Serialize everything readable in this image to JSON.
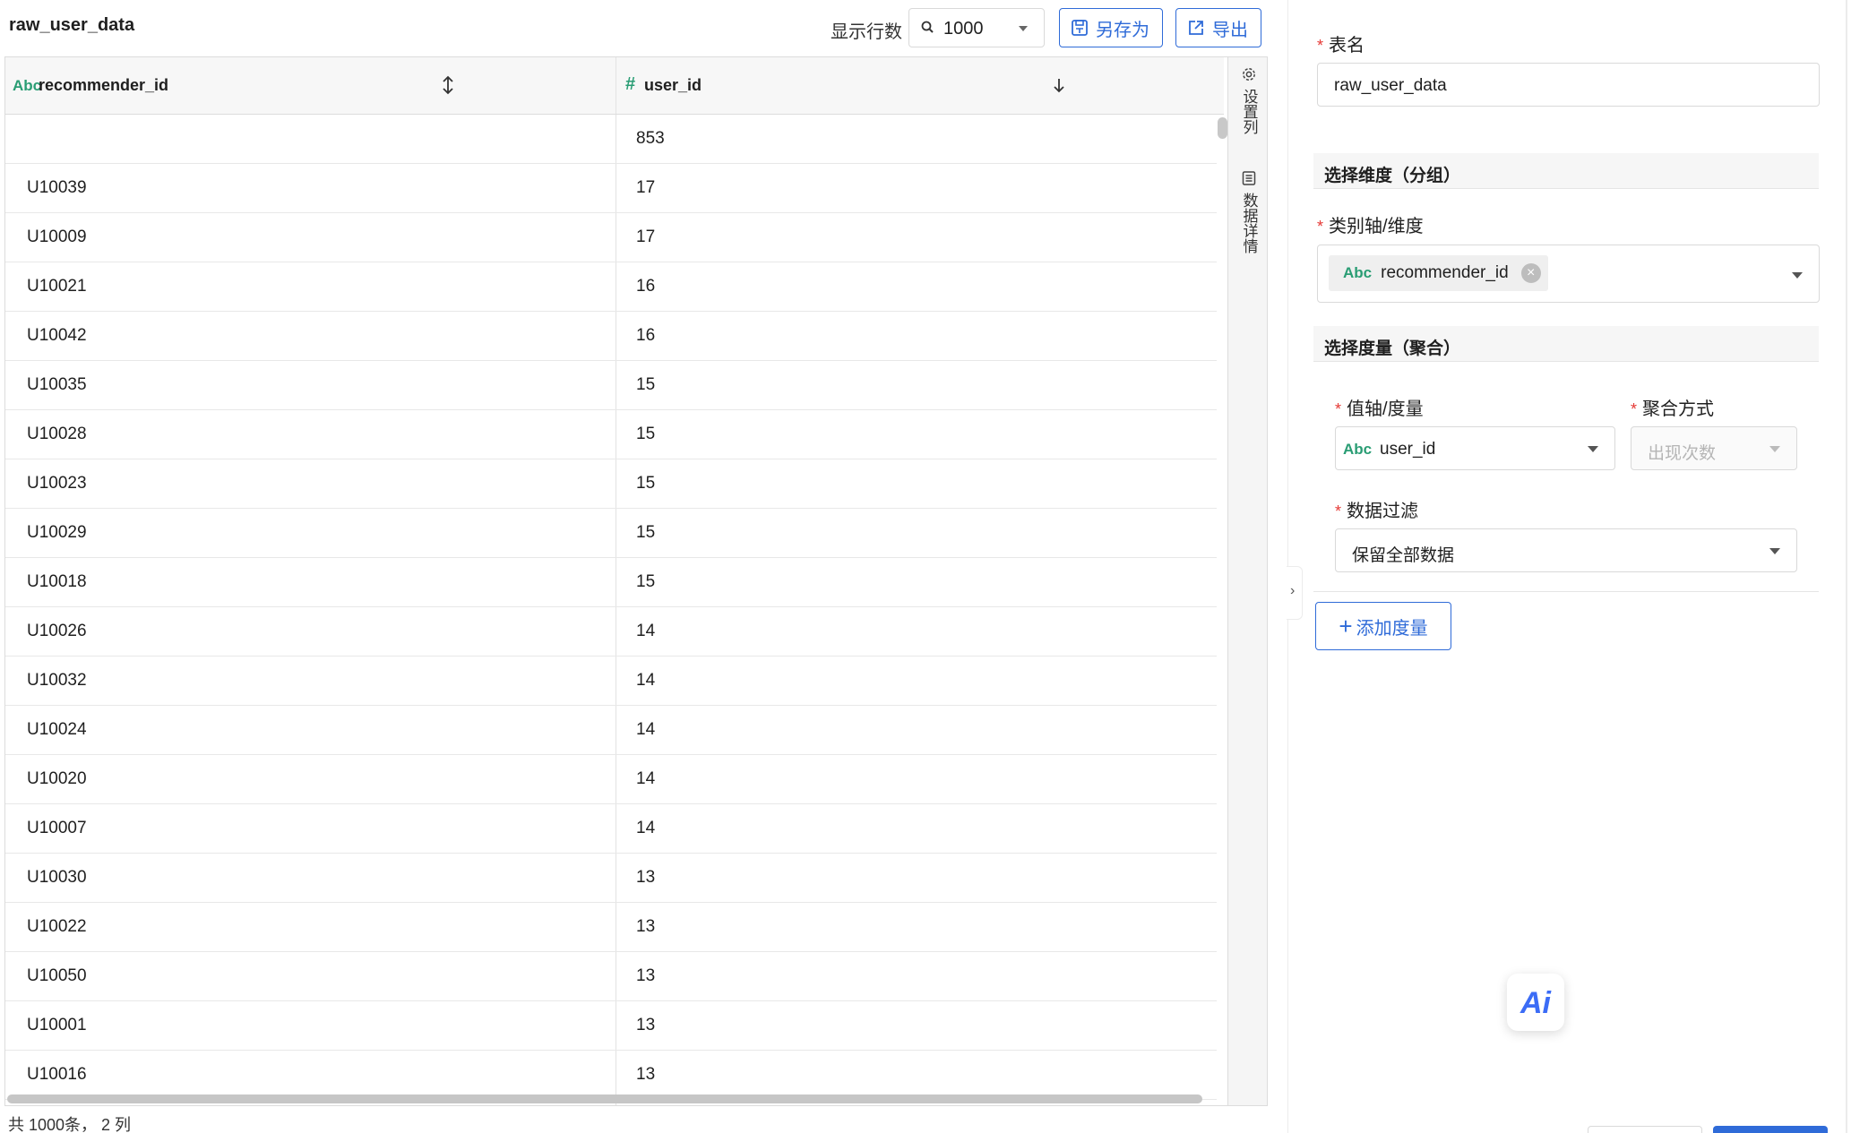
{
  "header": {
    "table_name": "raw_user_data",
    "rows_label": "显示行数",
    "rows_value": "1000",
    "save_as_label": "另存为",
    "export_label": "导出"
  },
  "grid": {
    "columns": [
      {
        "type": "Abc",
        "name": "recommender_id"
      },
      {
        "type": "#",
        "name": "user_id"
      }
    ],
    "rows": [
      {
        "a": "",
        "b": "853"
      },
      {
        "a": "U10039",
        "b": "17"
      },
      {
        "a": "U10009",
        "b": "17"
      },
      {
        "a": "U10021",
        "b": "16"
      },
      {
        "a": "U10042",
        "b": "16"
      },
      {
        "a": "U10035",
        "b": "15"
      },
      {
        "a": "U10028",
        "b": "15"
      },
      {
        "a": "U10023",
        "b": "15"
      },
      {
        "a": "U10029",
        "b": "15"
      },
      {
        "a": "U10018",
        "b": "15"
      },
      {
        "a": "U10026",
        "b": "14"
      },
      {
        "a": "U10032",
        "b": "14"
      },
      {
        "a": "U10024",
        "b": "14"
      },
      {
        "a": "U10020",
        "b": "14"
      },
      {
        "a": "U10007",
        "b": "14"
      },
      {
        "a": "U10030",
        "b": "13"
      },
      {
        "a": "U10022",
        "b": "13"
      },
      {
        "a": "U10050",
        "b": "13"
      },
      {
        "a": "U10001",
        "b": "13"
      },
      {
        "a": "U10016",
        "b": "13"
      }
    ],
    "side_tools": {
      "set_columns": "设置列",
      "data_details": "数据详情"
    },
    "footer": "共 1000条， 2 列"
  },
  "form": {
    "table_name_label": "表名",
    "table_name_value": "raw_user_data",
    "dimension_section": "选择维度（分组）",
    "category_axis_label": "类别轴/维度",
    "category_tag_type": "Abc",
    "category_tag_value": "recommender_id",
    "measure_section": "选择度量（聚合）",
    "value_axis_label": "值轴/度量",
    "value_axis_type": "Abc",
    "value_axis_value": "user_id",
    "agg_label": "聚合方式",
    "agg_value": "出现次数",
    "filter_label": "数据过滤",
    "filter_value": "保留全部数据",
    "add_measure_label": "添加度量",
    "ai_label": "Ai"
  },
  "colors": {
    "accent": "#2f6bd8",
    "type_green": "#2a9d74",
    "required": "#e53935"
  }
}
